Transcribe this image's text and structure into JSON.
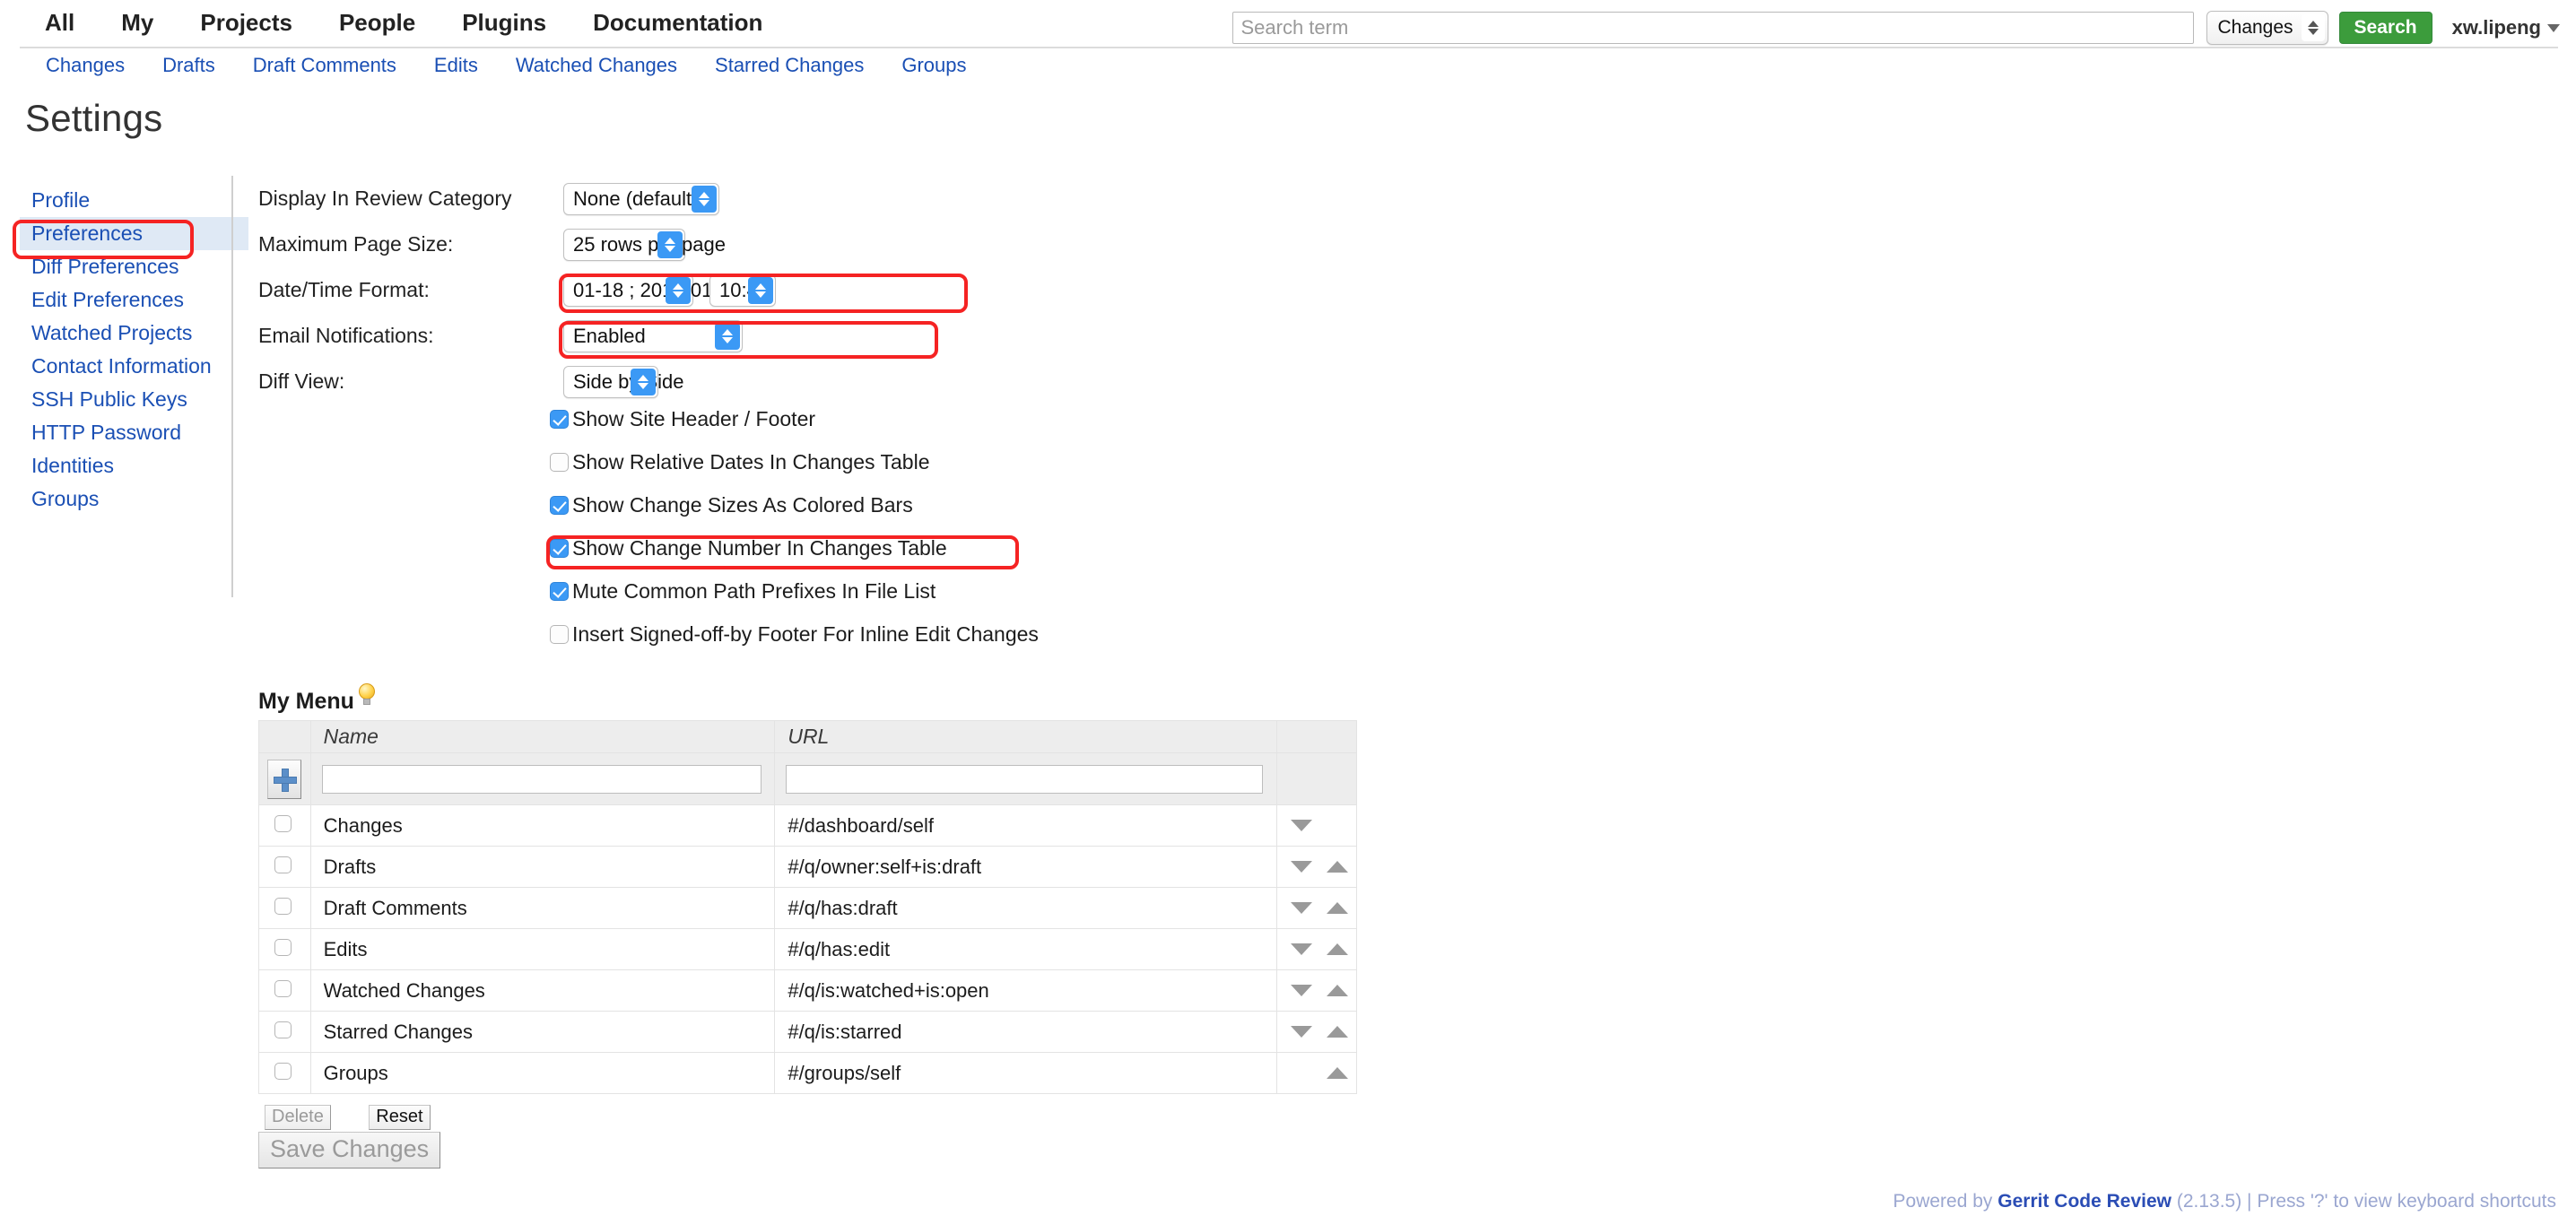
{
  "header": {
    "main_menu": [
      "All",
      "My",
      "Projects",
      "People",
      "Plugins",
      "Documentation"
    ],
    "sub_menu": [
      "Changes",
      "Drafts",
      "Draft Comments",
      "Edits",
      "Watched Changes",
      "Starred Changes",
      "Groups"
    ],
    "search": {
      "placeholder": "Search term",
      "value": "",
      "scope_selected": "Changes",
      "button_label": "Search"
    },
    "user": "xw.lipeng"
  },
  "page": {
    "title": "Settings"
  },
  "sidebar": {
    "items": [
      {
        "label": "Profile",
        "active": false
      },
      {
        "label": "Preferences",
        "active": true
      },
      {
        "label": "Diff Preferences",
        "active": false
      },
      {
        "label": "Edit Preferences",
        "active": false
      },
      {
        "label": "Watched Projects",
        "active": false
      },
      {
        "label": "Contact Information",
        "active": false
      },
      {
        "label": "SSH Public Keys",
        "active": false
      },
      {
        "label": "HTTP Password",
        "active": false
      },
      {
        "label": "Identities",
        "active": false
      },
      {
        "label": "Groups",
        "active": false
      }
    ]
  },
  "preferences": {
    "display_in_review_category": {
      "label": "Display In Review Category",
      "value": "None (default)"
    },
    "maximum_page_size": {
      "label": "Maximum Page Size:",
      "value": "25 rows per page"
    },
    "date_time_format": {
      "label": "Date/Time Format:",
      "date_value": "01-18 ; 2017-01-18",
      "time_value": "10:45"
    },
    "email_notifications": {
      "label": "Email Notifications:",
      "value": "Enabled"
    },
    "diff_view": {
      "label": "Diff View:",
      "value": "Side by Side"
    },
    "checkboxes": [
      {
        "label": "Show Site Header / Footer",
        "checked": true,
        "highlighted": false
      },
      {
        "label": "Show Relative Dates In Changes Table",
        "checked": false,
        "highlighted": false
      },
      {
        "label": "Show Change Sizes As Colored Bars",
        "checked": true,
        "highlighted": false
      },
      {
        "label": "Show Change Number In Changes Table",
        "checked": true,
        "highlighted": true
      },
      {
        "label": "Mute Common Path Prefixes In File List",
        "checked": true,
        "highlighted": false
      },
      {
        "label": "Insert Signed-off-by Footer For Inline Edit Changes",
        "checked": false,
        "highlighted": false
      }
    ]
  },
  "my_menu": {
    "title": "My Menu",
    "columns": {
      "name": "Name",
      "url": "URL"
    },
    "new_row": {
      "name_value": "",
      "url_value": ""
    },
    "rows": [
      {
        "name": "Changes",
        "url": "#/dashboard/self",
        "can_move_down": true,
        "can_move_up": false
      },
      {
        "name": "Drafts",
        "url": "#/q/owner:self+is:draft",
        "can_move_down": true,
        "can_move_up": true
      },
      {
        "name": "Draft Comments",
        "url": "#/q/has:draft",
        "can_move_down": true,
        "can_move_up": true
      },
      {
        "name": "Edits",
        "url": "#/q/has:edit",
        "can_move_down": true,
        "can_move_up": true
      },
      {
        "name": "Watched Changes",
        "url": "#/q/is:watched+is:open",
        "can_move_down": true,
        "can_move_up": true
      },
      {
        "name": "Starred Changes",
        "url": "#/q/is:starred",
        "can_move_down": true,
        "can_move_up": true
      },
      {
        "name": "Groups",
        "url": "#/groups/self",
        "can_move_down": false,
        "can_move_up": true
      }
    ],
    "delete_label": "Delete",
    "reset_label": "Reset"
  },
  "actions": {
    "save_changes": "Save Changes"
  },
  "footer": {
    "powered_by": "Powered by ",
    "brand": "Gerrit Code Review",
    "version": " (2.13.5) | Press '?' to view keyboard shortcuts"
  },
  "colors": {
    "link": "#1a4fb4",
    "accent_green": "#3c9c3c",
    "checkbox_on": "#3b99f5",
    "highlight_red": "#f52323",
    "active_nav_bg": "#dfe9f5"
  }
}
